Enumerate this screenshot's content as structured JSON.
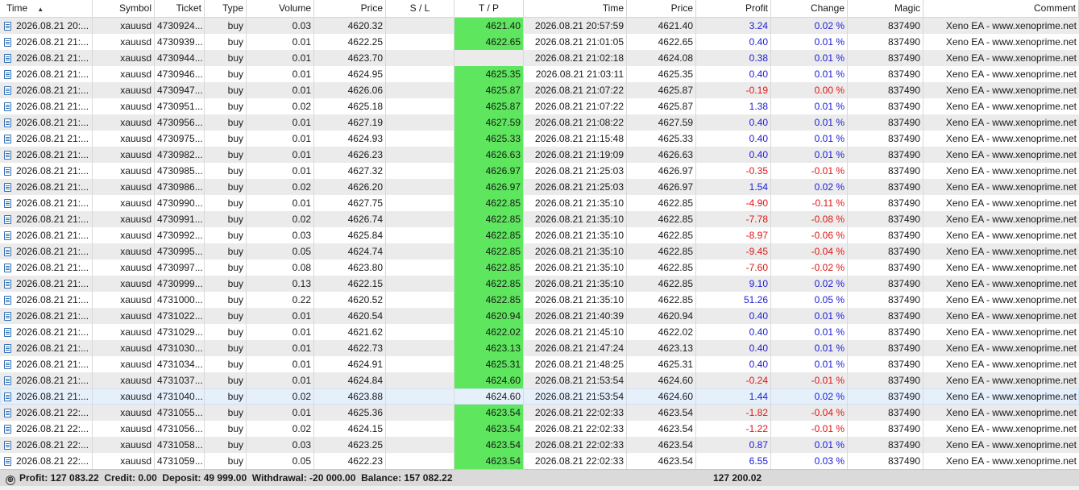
{
  "columns": [
    "Time",
    "Symbol",
    "Ticket",
    "Type",
    "Volume",
    "Price",
    "S / L",
    "T / P",
    "Time",
    "Price",
    "Profit",
    "Change",
    "Magic",
    "Comment"
  ],
  "sort_indicator": "▲",
  "colors": {
    "tp_fill": "#5ee65e",
    "profit_positive": "#1c1cd6",
    "profit_negative": "#e01616",
    "row_alt": "#ebebeb",
    "row_selected": "#e5f0fb"
  },
  "rows": [
    {
      "time": "2026.08.21 20:...",
      "symbol": "xauusd",
      "ticket": "4730924...",
      "type": "buy",
      "volume": "0.03",
      "price": "4620.32",
      "sl": "",
      "tp": "4621.40",
      "close_time": "2026.08.21 20:57:59",
      "close_price": "4621.40",
      "profit": "3.24",
      "change": "0.02 %",
      "magic": "837490",
      "comment": "Xeno EA - www.xenoprime.net"
    },
    {
      "time": "2026.08.21 21:...",
      "symbol": "xauusd",
      "ticket": "4730939...",
      "type": "buy",
      "volume": "0.01",
      "price": "4622.25",
      "sl": "",
      "tp": "4622.65",
      "close_time": "2026.08.21 21:01:05",
      "close_price": "4622.65",
      "profit": "0.40",
      "change": "0.01 %",
      "magic": "837490",
      "comment": "Xeno EA - www.xenoprime.net"
    },
    {
      "time": "2026.08.21 21:...",
      "symbol": "xauusd",
      "ticket": "4730944...",
      "type": "buy",
      "volume": "0.01",
      "price": "4623.70",
      "sl": "",
      "tp": "",
      "close_time": "2026.08.21 21:02:18",
      "close_price": "4624.08",
      "profit": "0.38",
      "change": "0.01 %",
      "magic": "837490",
      "comment": "Xeno EA - www.xenoprime.net"
    },
    {
      "time": "2026.08.21 21:...",
      "symbol": "xauusd",
      "ticket": "4730946...",
      "type": "buy",
      "volume": "0.01",
      "price": "4624.95",
      "sl": "",
      "tp": "4625.35",
      "close_time": "2026.08.21 21:03:11",
      "close_price": "4625.35",
      "profit": "0.40",
      "change": "0.01 %",
      "magic": "837490",
      "comment": "Xeno EA - www.xenoprime.net"
    },
    {
      "time": "2026.08.21 21:...",
      "symbol": "xauusd",
      "ticket": "4730947...",
      "type": "buy",
      "volume": "0.01",
      "price": "4626.06",
      "sl": "",
      "tp": "4625.87",
      "close_time": "2026.08.21 21:07:22",
      "close_price": "4625.87",
      "profit": "-0.19",
      "change": "0.00 %",
      "magic": "837490",
      "comment": "Xeno EA - www.xenoprime.net"
    },
    {
      "time": "2026.08.21 21:...",
      "symbol": "xauusd",
      "ticket": "4730951...",
      "type": "buy",
      "volume": "0.02",
      "price": "4625.18",
      "sl": "",
      "tp": "4625.87",
      "close_time": "2026.08.21 21:07:22",
      "close_price": "4625.87",
      "profit": "1.38",
      "change": "0.01 %",
      "magic": "837490",
      "comment": "Xeno EA - www.xenoprime.net"
    },
    {
      "time": "2026.08.21 21:...",
      "symbol": "xauusd",
      "ticket": "4730956...",
      "type": "buy",
      "volume": "0.01",
      "price": "4627.19",
      "sl": "",
      "tp": "4627.59",
      "close_time": "2026.08.21 21:08:22",
      "close_price": "4627.59",
      "profit": "0.40",
      "change": "0.01 %",
      "magic": "837490",
      "comment": "Xeno EA - www.xenoprime.net"
    },
    {
      "time": "2026.08.21 21:...",
      "symbol": "xauusd",
      "ticket": "4730975...",
      "type": "buy",
      "volume": "0.01",
      "price": "4624.93",
      "sl": "",
      "tp": "4625.33",
      "close_time": "2026.08.21 21:15:48",
      "close_price": "4625.33",
      "profit": "0.40",
      "change": "0.01 %",
      "magic": "837490",
      "comment": "Xeno EA - www.xenoprime.net"
    },
    {
      "time": "2026.08.21 21:...",
      "symbol": "xauusd",
      "ticket": "4730982...",
      "type": "buy",
      "volume": "0.01",
      "price": "4626.23",
      "sl": "",
      "tp": "4626.63",
      "close_time": "2026.08.21 21:19:09",
      "close_price": "4626.63",
      "profit": "0.40",
      "change": "0.01 %",
      "magic": "837490",
      "comment": "Xeno EA - www.xenoprime.net"
    },
    {
      "time": "2026.08.21 21:...",
      "symbol": "xauusd",
      "ticket": "4730985...",
      "type": "buy",
      "volume": "0.01",
      "price": "4627.32",
      "sl": "",
      "tp": "4626.97",
      "close_time": "2026.08.21 21:25:03",
      "close_price": "4626.97",
      "profit": "-0.35",
      "change": "-0.01 %",
      "magic": "837490",
      "comment": "Xeno EA - www.xenoprime.net"
    },
    {
      "time": "2026.08.21 21:...",
      "symbol": "xauusd",
      "ticket": "4730986...",
      "type": "buy",
      "volume": "0.02",
      "price": "4626.20",
      "sl": "",
      "tp": "4626.97",
      "close_time": "2026.08.21 21:25:03",
      "close_price": "4626.97",
      "profit": "1.54",
      "change": "0.02 %",
      "magic": "837490",
      "comment": "Xeno EA - www.xenoprime.net"
    },
    {
      "time": "2026.08.21 21:...",
      "symbol": "xauusd",
      "ticket": "4730990...",
      "type": "buy",
      "volume": "0.01",
      "price": "4627.75",
      "sl": "",
      "tp": "4622.85",
      "close_time": "2026.08.21 21:35:10",
      "close_price": "4622.85",
      "profit": "-4.90",
      "change": "-0.11 %",
      "magic": "837490",
      "comment": "Xeno EA - www.xenoprime.net"
    },
    {
      "time": "2026.08.21 21:...",
      "symbol": "xauusd",
      "ticket": "4730991...",
      "type": "buy",
      "volume": "0.02",
      "price": "4626.74",
      "sl": "",
      "tp": "4622.85",
      "close_time": "2026.08.21 21:35:10",
      "close_price": "4622.85",
      "profit": "-7.78",
      "change": "-0.08 %",
      "magic": "837490",
      "comment": "Xeno EA - www.xenoprime.net"
    },
    {
      "time": "2026.08.21 21:...",
      "symbol": "xauusd",
      "ticket": "4730992...",
      "type": "buy",
      "volume": "0.03",
      "price": "4625.84",
      "sl": "",
      "tp": "4622.85",
      "close_time": "2026.08.21 21:35:10",
      "close_price": "4622.85",
      "profit": "-8.97",
      "change": "-0.06 %",
      "magic": "837490",
      "comment": "Xeno EA - www.xenoprime.net"
    },
    {
      "time": "2026.08.21 21:...",
      "symbol": "xauusd",
      "ticket": "4730995...",
      "type": "buy",
      "volume": "0.05",
      "price": "4624.74",
      "sl": "",
      "tp": "4622.85",
      "close_time": "2026.08.21 21:35:10",
      "close_price": "4622.85",
      "profit": "-9.45",
      "change": "-0.04 %",
      "magic": "837490",
      "comment": "Xeno EA - www.xenoprime.net"
    },
    {
      "time": "2026.08.21 21:...",
      "symbol": "xauusd",
      "ticket": "4730997...",
      "type": "buy",
      "volume": "0.08",
      "price": "4623.80",
      "sl": "",
      "tp": "4622.85",
      "close_time": "2026.08.21 21:35:10",
      "close_price": "4622.85",
      "profit": "-7.60",
      "change": "-0.02 %",
      "magic": "837490",
      "comment": "Xeno EA - www.xenoprime.net"
    },
    {
      "time": "2026.08.21 21:...",
      "symbol": "xauusd",
      "ticket": "4730999...",
      "type": "buy",
      "volume": "0.13",
      "price": "4622.15",
      "sl": "",
      "tp": "4622.85",
      "close_time": "2026.08.21 21:35:10",
      "close_price": "4622.85",
      "profit": "9.10",
      "change": "0.02 %",
      "magic": "837490",
      "comment": "Xeno EA - www.xenoprime.net"
    },
    {
      "time": "2026.08.21 21:...",
      "symbol": "xauusd",
      "ticket": "4731000...",
      "type": "buy",
      "volume": "0.22",
      "price": "4620.52",
      "sl": "",
      "tp": "4622.85",
      "close_time": "2026.08.21 21:35:10",
      "close_price": "4622.85",
      "profit": "51.26",
      "change": "0.05 %",
      "magic": "837490",
      "comment": "Xeno EA - www.xenoprime.net"
    },
    {
      "time": "2026.08.21 21:...",
      "symbol": "xauusd",
      "ticket": "4731022...",
      "type": "buy",
      "volume": "0.01",
      "price": "4620.54",
      "sl": "",
      "tp": "4620.94",
      "close_time": "2026.08.21 21:40:39",
      "close_price": "4620.94",
      "profit": "0.40",
      "change": "0.01 %",
      "magic": "837490",
      "comment": "Xeno EA - www.xenoprime.net"
    },
    {
      "time": "2026.08.21 21:...",
      "symbol": "xauusd",
      "ticket": "4731029...",
      "type": "buy",
      "volume": "0.01",
      "price": "4621.62",
      "sl": "",
      "tp": "4622.02",
      "close_time": "2026.08.21 21:45:10",
      "close_price": "4622.02",
      "profit": "0.40",
      "change": "0.01 %",
      "magic": "837490",
      "comment": "Xeno EA - www.xenoprime.net"
    },
    {
      "time": "2026.08.21 21:...",
      "symbol": "xauusd",
      "ticket": "4731030...",
      "type": "buy",
      "volume": "0.01",
      "price": "4622.73",
      "sl": "",
      "tp": "4623.13",
      "close_time": "2026.08.21 21:47:24",
      "close_price": "4623.13",
      "profit": "0.40",
      "change": "0.01 %",
      "magic": "837490",
      "comment": "Xeno EA - www.xenoprime.net"
    },
    {
      "time": "2026.08.21 21:...",
      "symbol": "xauusd",
      "ticket": "4731034...",
      "type": "buy",
      "volume": "0.01",
      "price": "4624.91",
      "sl": "",
      "tp": "4625.31",
      "close_time": "2026.08.21 21:48:25",
      "close_price": "4625.31",
      "profit": "0.40",
      "change": "0.01 %",
      "magic": "837490",
      "comment": "Xeno EA - www.xenoprime.net"
    },
    {
      "time": "2026.08.21 21:...",
      "symbol": "xauusd",
      "ticket": "4731037...",
      "type": "buy",
      "volume": "0.01",
      "price": "4624.84",
      "sl": "",
      "tp": "4624.60",
      "close_time": "2026.08.21 21:53:54",
      "close_price": "4624.60",
      "profit": "-0.24",
      "change": "-0.01 %",
      "magic": "837490",
      "comment": "Xeno EA - www.xenoprime.net"
    },
    {
      "time": "2026.08.21 21:...",
      "symbol": "xauusd",
      "ticket": "4731040...",
      "type": "buy",
      "volume": "0.02",
      "price": "4623.88",
      "sl": "",
      "tp": "4624.60",
      "close_time": "2026.08.21 21:53:54",
      "close_price": "4624.60",
      "profit": "1.44",
      "change": "0.02 %",
      "magic": "837490",
      "comment": "Xeno EA - www.xenoprime.net",
      "selected": true
    },
    {
      "time": "2026.08.21 22:...",
      "symbol": "xauusd",
      "ticket": "4731055...",
      "type": "buy",
      "volume": "0.01",
      "price": "4625.36",
      "sl": "",
      "tp": "4623.54",
      "close_time": "2026.08.21 22:02:33",
      "close_price": "4623.54",
      "profit": "-1.82",
      "change": "-0.04 %",
      "magic": "837490",
      "comment": "Xeno EA - www.xenoprime.net"
    },
    {
      "time": "2026.08.21 22:...",
      "symbol": "xauusd",
      "ticket": "4731056...",
      "type": "buy",
      "volume": "0.02",
      "price": "4624.15",
      "sl": "",
      "tp": "4623.54",
      "close_time": "2026.08.21 22:02:33",
      "close_price": "4623.54",
      "profit": "-1.22",
      "change": "-0.01 %",
      "magic": "837490",
      "comment": "Xeno EA - www.xenoprime.net"
    },
    {
      "time": "2026.08.21 22:...",
      "symbol": "xauusd",
      "ticket": "4731058...",
      "type": "buy",
      "volume": "0.03",
      "price": "4623.25",
      "sl": "",
      "tp": "4623.54",
      "close_time": "2026.08.21 22:02:33",
      "close_price": "4623.54",
      "profit": "0.87",
      "change": "0.01 %",
      "magic": "837490",
      "comment": "Xeno EA - www.xenoprime.net"
    },
    {
      "time": "2026.08.21 22:...",
      "symbol": "xauusd",
      "ticket": "4731059...",
      "type": "buy",
      "volume": "0.05",
      "price": "4622.23",
      "sl": "",
      "tp": "4623.54",
      "close_time": "2026.08.21 22:02:33",
      "close_price": "4623.54",
      "profit": "6.55",
      "change": "0.03 %",
      "magic": "837490",
      "comment": "Xeno EA - www.xenoprime.net"
    }
  ],
  "footer": {
    "expand_icon": "⊕",
    "summary": "Profit: 127 083.22  Credit: 0.00  Deposit: 49 999.00  Withdrawal: -20 000.00  Balance: 157 082.22",
    "total_profit": "127 200.02"
  }
}
